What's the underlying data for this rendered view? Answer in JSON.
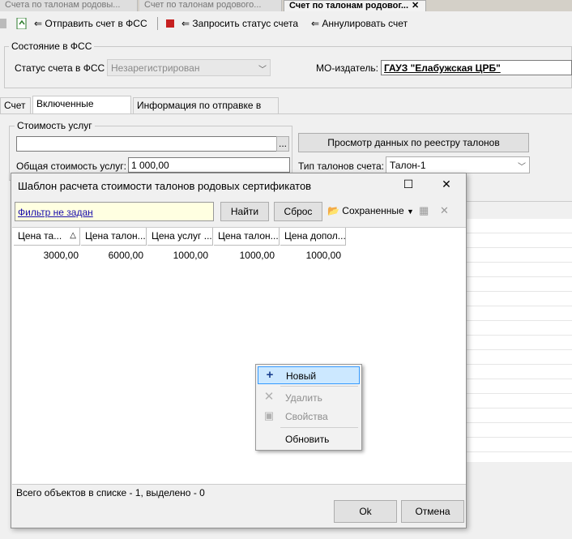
{
  "doc_tabs": [
    {
      "label": "Счета по талонам родовы...",
      "active": false
    },
    {
      "label": "Счет по талонам родового...",
      "active": false
    },
    {
      "label": "Счет по талонам родовог...",
      "active": true,
      "close": "✕"
    }
  ],
  "toolbar": {
    "send_label": "Отправить счет в ФСС",
    "request_status_label": "Запросить статус счета",
    "annul_label": "Аннулировать счет"
  },
  "fss_state": {
    "group_title": "Состояние в ФСС",
    "status_label": "Статус счета в ФСС",
    "status_value": "Незарегистрирован",
    "mo_label": "МО-издатель:",
    "mo_value": "ГАУЗ \"Елабужская ЦРБ\""
  },
  "sub_tabs": [
    {
      "label": "Счет",
      "active": false
    },
    {
      "label": "Включенные талоны",
      "active": true
    },
    {
      "label": "Информация по отправке в ФСС",
      "active": false
    }
  ],
  "services": {
    "group_title": "Стоимость услуг",
    "ellipsis": "...",
    "registry_button": "Просмотр данных по реестру талонов",
    "total_label": "Общая стоимость услуг:",
    "total_value": "1 000,00",
    "type_label": "Тип талонов счета:",
    "type_value": "Талон-1"
  },
  "dialog": {
    "title": "Шаблон расчета стоимости талонов родовых сертификатов",
    "filter_text": "Фильтр не задан",
    "find_button": "Найти",
    "reset_button": "Сброс",
    "saved_label": "Сохраненные",
    "columns": [
      "Цена та...",
      "Цена талон...",
      "Цена услуг ...",
      "Цена талон...",
      "Цена допол..."
    ],
    "rows": [
      [
        "3000,00",
        "6000,00",
        "1000,00",
        "1000,00",
        "1000,00"
      ]
    ],
    "status_text": "Всего объектов в списке - 1, выделено - 0",
    "ok_button": "Ok",
    "cancel_button": "Отмена"
  },
  "context_menu": {
    "new": "Новый",
    "delete": "Удалить",
    "properties": "Свойства",
    "refresh": "Обновить"
  }
}
